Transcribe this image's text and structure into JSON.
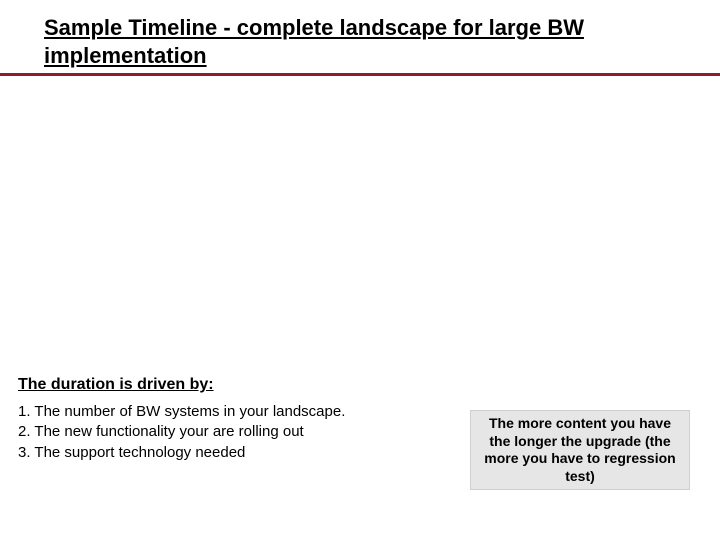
{
  "title": "Sample Timeline - complete landscape for large BW implementation",
  "driven": {
    "heading": "The duration is driven by:",
    "items": [
      "1. The number of BW systems in your landscape.",
      "2. The new functionality your are rolling out",
      "3. The support technology needed"
    ]
  },
  "note": "The more content you have the longer the upgrade (the more you have to regression test)"
}
